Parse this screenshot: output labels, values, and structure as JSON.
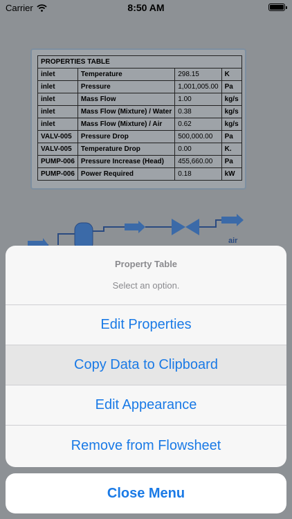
{
  "status_bar": {
    "carrier": "Carrier",
    "time": "8:50 AM"
  },
  "properties_table": {
    "title": "PROPERTIES TABLE",
    "rows": [
      [
        "inlet",
        "Temperature",
        "298.15",
        "K"
      ],
      [
        "inlet",
        "Pressure",
        "1,001,005.00",
        "Pa"
      ],
      [
        "inlet",
        "Mass Flow",
        "1.00",
        "kg/s"
      ],
      [
        "inlet",
        "Mass Flow (Mixture) / Water",
        "0.38",
        "kg/s"
      ],
      [
        "inlet",
        "Mass Flow (Mixture) / Air",
        "0.62",
        "kg/s"
      ],
      [
        "VALV-005",
        "Pressure Drop",
        "500,000.00",
        "Pa"
      ],
      [
        "VALV-005",
        "Temperature Drop",
        "0.00",
        "K."
      ],
      [
        "PUMP-006",
        "Pressure Increase (Head)",
        "455,660.00",
        "Pa"
      ],
      [
        "PUMP-006",
        "Power Required",
        "0.18",
        "kW"
      ]
    ]
  },
  "flowsheet": {
    "stream_label": "air"
  },
  "action_sheet": {
    "title": "Property Table",
    "message": "Select an option.",
    "options": [
      "Edit Properties",
      "Copy Data to Clipboard",
      "Edit Appearance",
      "Remove from Flowsheet"
    ],
    "cancel_label": "Close Menu"
  },
  "colors": {
    "accent": "#1a7ae6",
    "sheet_bg": "#f7f7f7",
    "dim_bg": "#8d9195"
  }
}
